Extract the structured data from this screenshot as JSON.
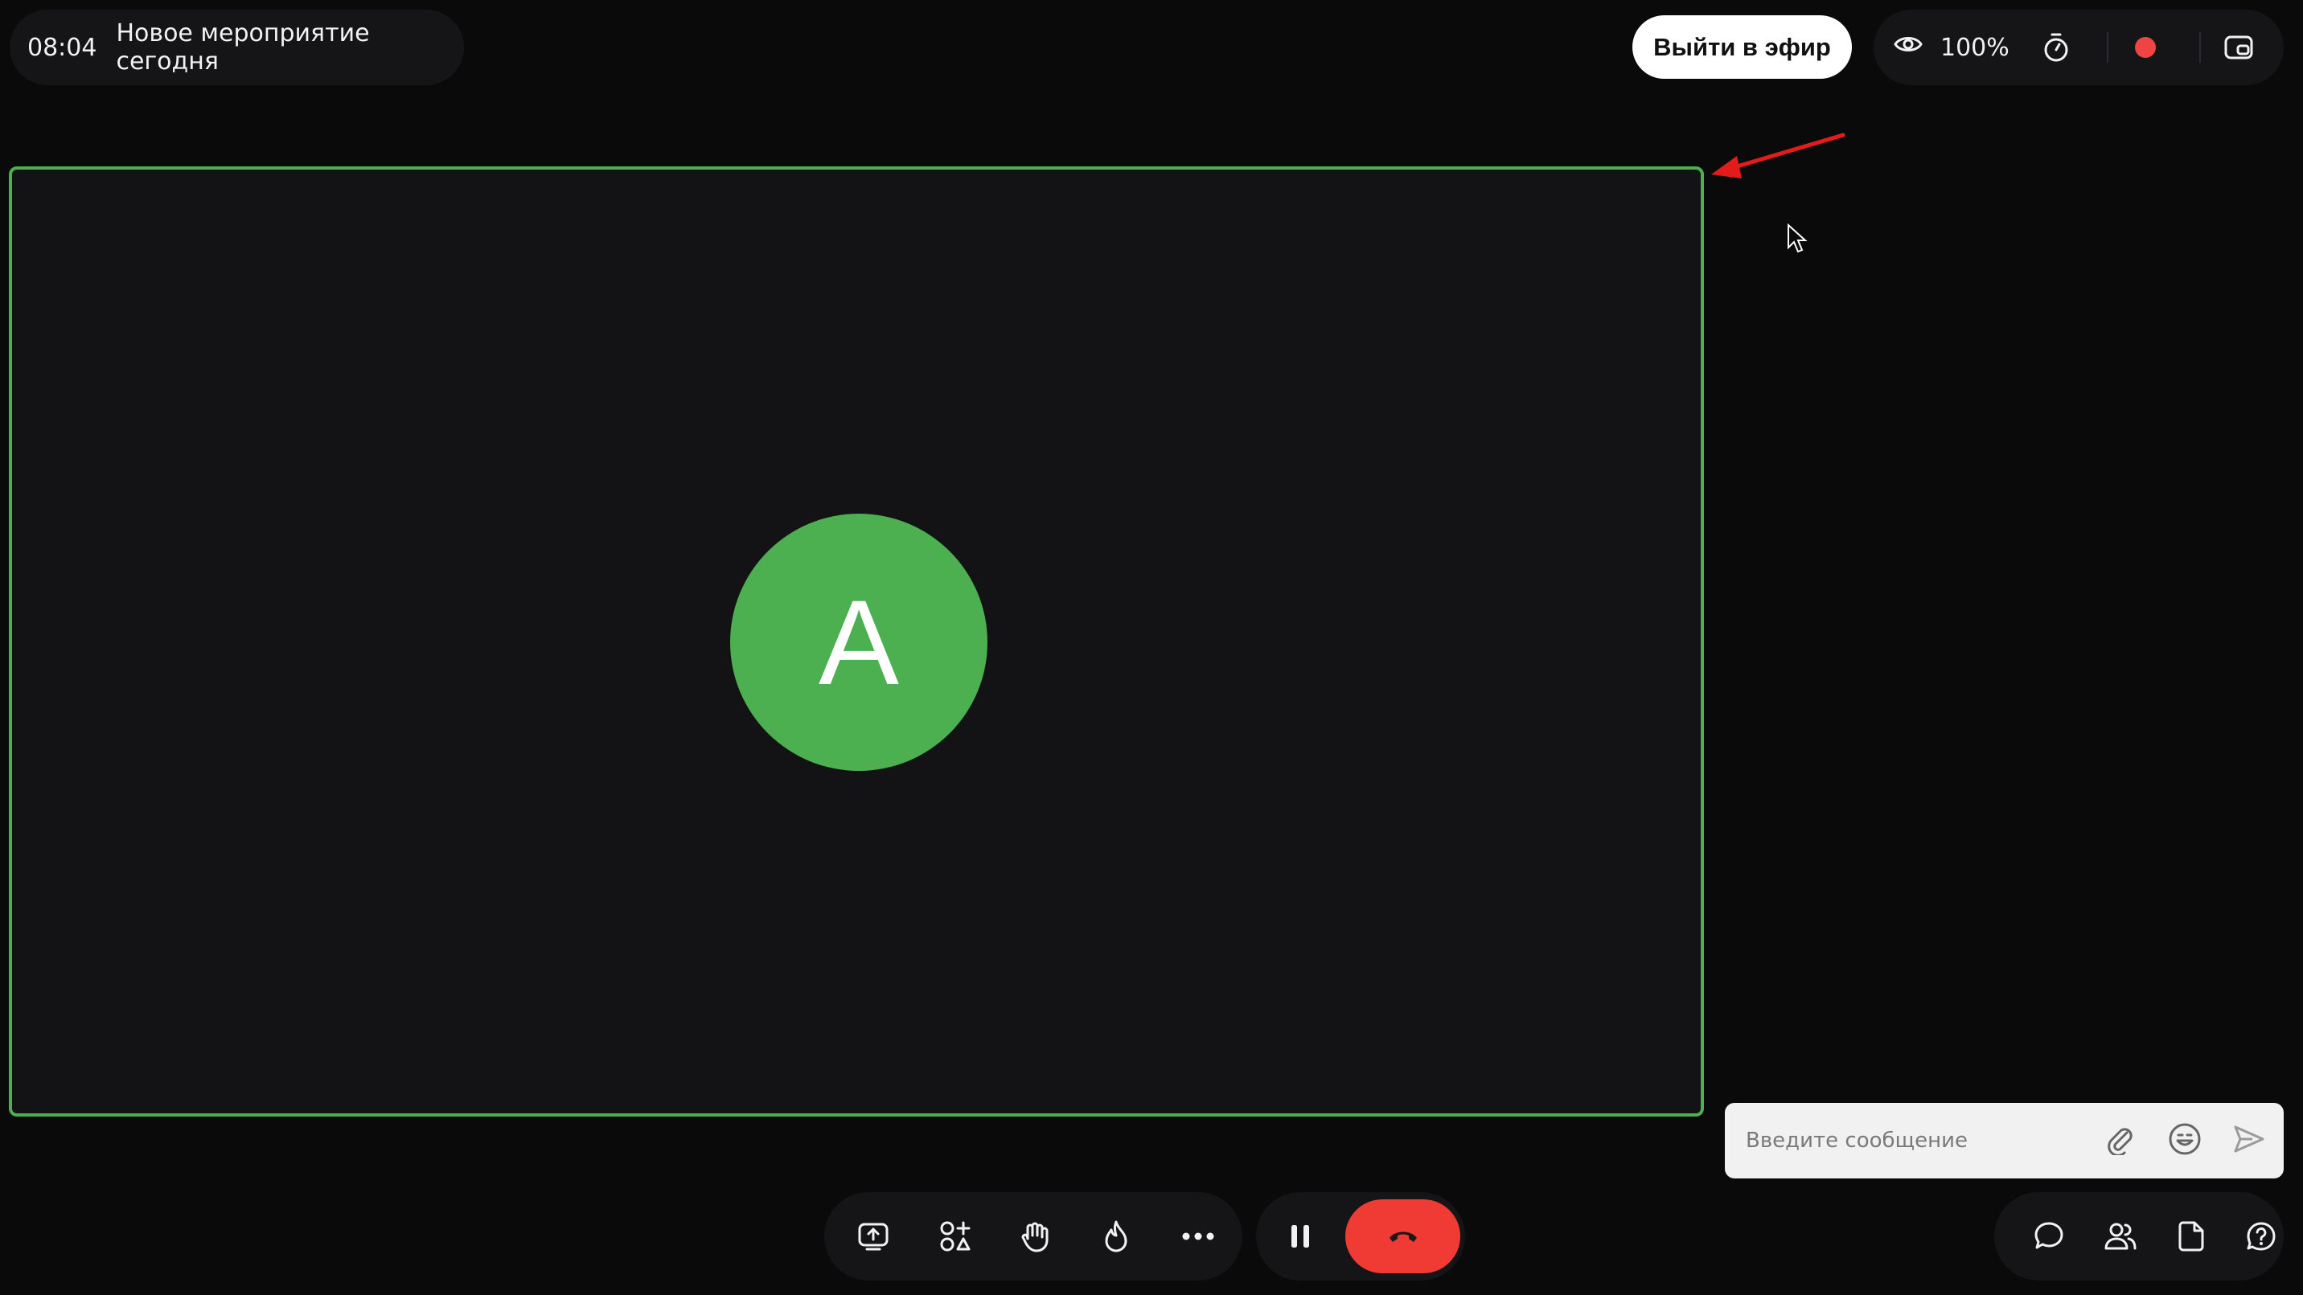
{
  "header": {
    "time": "08:04",
    "meeting_title": "Новое мероприятие сегодня",
    "go_live_label": "Выйти в эфир",
    "zoom_level": "100%"
  },
  "video": {
    "participant_initial": "A",
    "avatar_color": "#4caf50",
    "active_border_color": "#4caf50"
  },
  "chat": {
    "placeholder": "Введите сообщение"
  },
  "icons": {
    "viewers": "eye-icon",
    "timer": "stopwatch-icon",
    "record": "record-dot-icon",
    "pip": "picture-in-picture-icon",
    "attach": "paperclip-icon",
    "emoji": "emoji-icon",
    "send": "send-icon",
    "share_screen": "share-screen-icon",
    "apps": "apps-add-icon",
    "raise_hand": "hand-icon",
    "reactions": "fire-icon",
    "more": "more-icon",
    "pause": "pause-icon",
    "hangup": "hang-up-icon",
    "chat": "chat-icon",
    "participants": "participants-icon",
    "files": "file-icon",
    "help": "help-icon"
  },
  "colors": {
    "accent_record": "#ef4444",
    "hangup": "#ef3b34",
    "annotation_arrow": "#e41b1b"
  }
}
